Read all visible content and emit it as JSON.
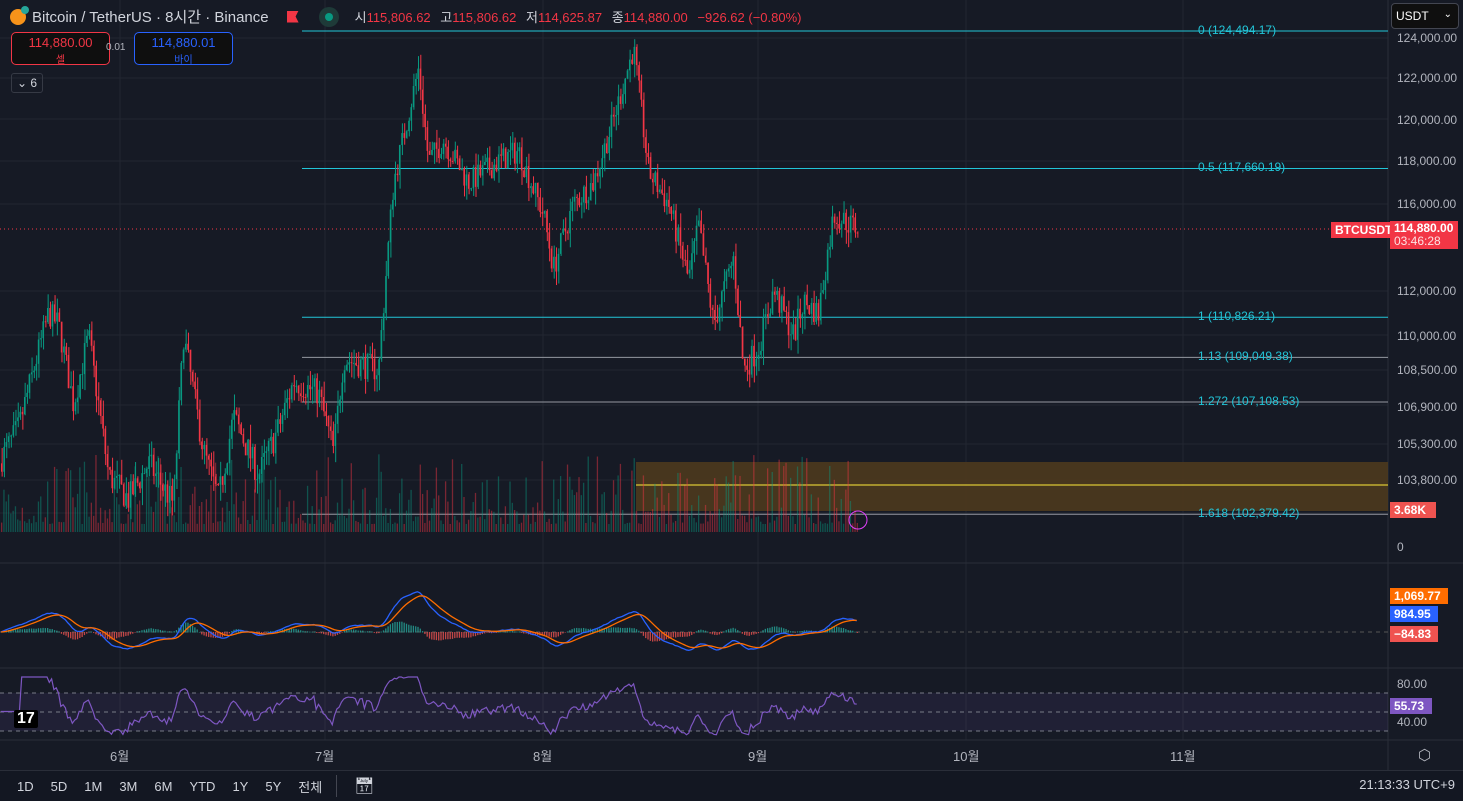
{
  "header": {
    "symbol": "Bitcoin / TetherUS · 8시간 · Binance",
    "ohlc": [
      {
        "k": "시",
        "v": "115,806.62"
      },
      {
        "k": "고",
        "v": "115,806.62"
      },
      {
        "k": "저",
        "v": "114,625.87"
      },
      {
        "k": "종",
        "v": "114,880.00"
      }
    ],
    "change": "−926.62 (−0.80%)"
  },
  "trade": {
    "sell_price": "114,880.00",
    "sell_label": "셀",
    "spread": "0.01",
    "buy_price": "114,880.01",
    "buy_label": "바이"
  },
  "indicators_count": "6",
  "currency": "USDT",
  "price_axis": [
    "124,000.00",
    "122,000.00",
    "120,000.00",
    "118,000.00",
    "116,000.00",
    "112,000.00",
    "110,000.00",
    "108,500.00",
    "106,900.00",
    "105,300.00",
    "103,800.00",
    "0"
  ],
  "price_values": [
    124000,
    122000,
    120000,
    118000,
    116000,
    112000,
    110000,
    108500,
    106900,
    105300,
    103800
  ],
  "last_price": {
    "symbol": "BTCUSDT",
    "price": "114,880.00",
    "countdown": "03:46:28",
    "value": 114880
  },
  "volume_label": "3.68K",
  "fib": [
    {
      "label": "0 (124,494.17)",
      "value": 124494.17,
      "color": "#22c5d8"
    },
    {
      "label": "0.5 (117,660.19)",
      "value": 117660.19,
      "color": "#22c5d8"
    },
    {
      "label": "1 (110,826.21)",
      "value": 110826.21,
      "color": "#22c5d8"
    },
    {
      "label": "1.13 (109,049.38)",
      "value": 109049.38,
      "color": "#9598a1"
    },
    {
      "label": "1.272 (107,108.53)",
      "value": 107108.53,
      "color": "#9598a1"
    },
    {
      "label": "1.618 (102,379.42)",
      "value": 102379.42,
      "color": "#9598a1"
    }
  ],
  "macd": {
    "signal": "1,069.77",
    "macd": "984.95",
    "hist": "−84.83"
  },
  "rsi": {
    "levels": [
      "80.00",
      "40.00"
    ],
    "value": "55.73"
  },
  "months": [
    "6월",
    "7월",
    "8월",
    "9월",
    "10월",
    "11월"
  ],
  "ranges": [
    "1D",
    "5D",
    "1M",
    "3M",
    "6M",
    "YTD",
    "1Y",
    "5Y",
    "전체"
  ],
  "clock": "21:13:33 UTC+9",
  "price_path": [
    [
      0,
      104500
    ],
    [
      20,
      106000
    ],
    [
      50,
      111000
    ],
    [
      60,
      110500
    ],
    [
      75,
      107000
    ],
    [
      90,
      110000
    ],
    [
      110,
      104000
    ],
    [
      130,
      103000
    ],
    [
      150,
      104500
    ],
    [
      175,
      102800
    ],
    [
      185,
      110000
    ],
    [
      205,
      105000
    ],
    [
      220,
      103000
    ],
    [
      235,
      106500
    ],
    [
      260,
      104000
    ],
    [
      280,
      106000
    ],
    [
      295,
      108000
    ],
    [
      320,
      107500
    ],
    [
      335,
      105000
    ],
    [
      345,
      109000
    ],
    [
      380,
      108500
    ],
    [
      395,
      117000
    ],
    [
      420,
      122500
    ],
    [
      430,
      118000
    ],
    [
      445,
      119000
    ],
    [
      470,
      117000
    ],
    [
      500,
      118000
    ],
    [
      520,
      118500
    ],
    [
      545,
      115500
    ],
    [
      555,
      113000
    ],
    [
      575,
      116000
    ],
    [
      595,
      117000
    ],
    [
      615,
      120000
    ],
    [
      635,
      123500
    ],
    [
      650,
      117500
    ],
    [
      670,
      116000
    ],
    [
      690,
      112500
    ],
    [
      700,
      115000
    ],
    [
      715,
      110500
    ],
    [
      735,
      113500
    ],
    [
      745,
      108500
    ],
    [
      760,
      109500
    ],
    [
      775,
      112000
    ],
    [
      795,
      110000
    ],
    [
      805,
      111500
    ],
    [
      820,
      111000
    ],
    [
      835,
      115500
    ],
    [
      858,
      114880
    ]
  ],
  "colors": {
    "up": "#089981",
    "down": "#f23645",
    "bg": "#161a25",
    "macd": "#2962ff",
    "signal": "#ff6d00",
    "rsi": "#7e57c2"
  }
}
